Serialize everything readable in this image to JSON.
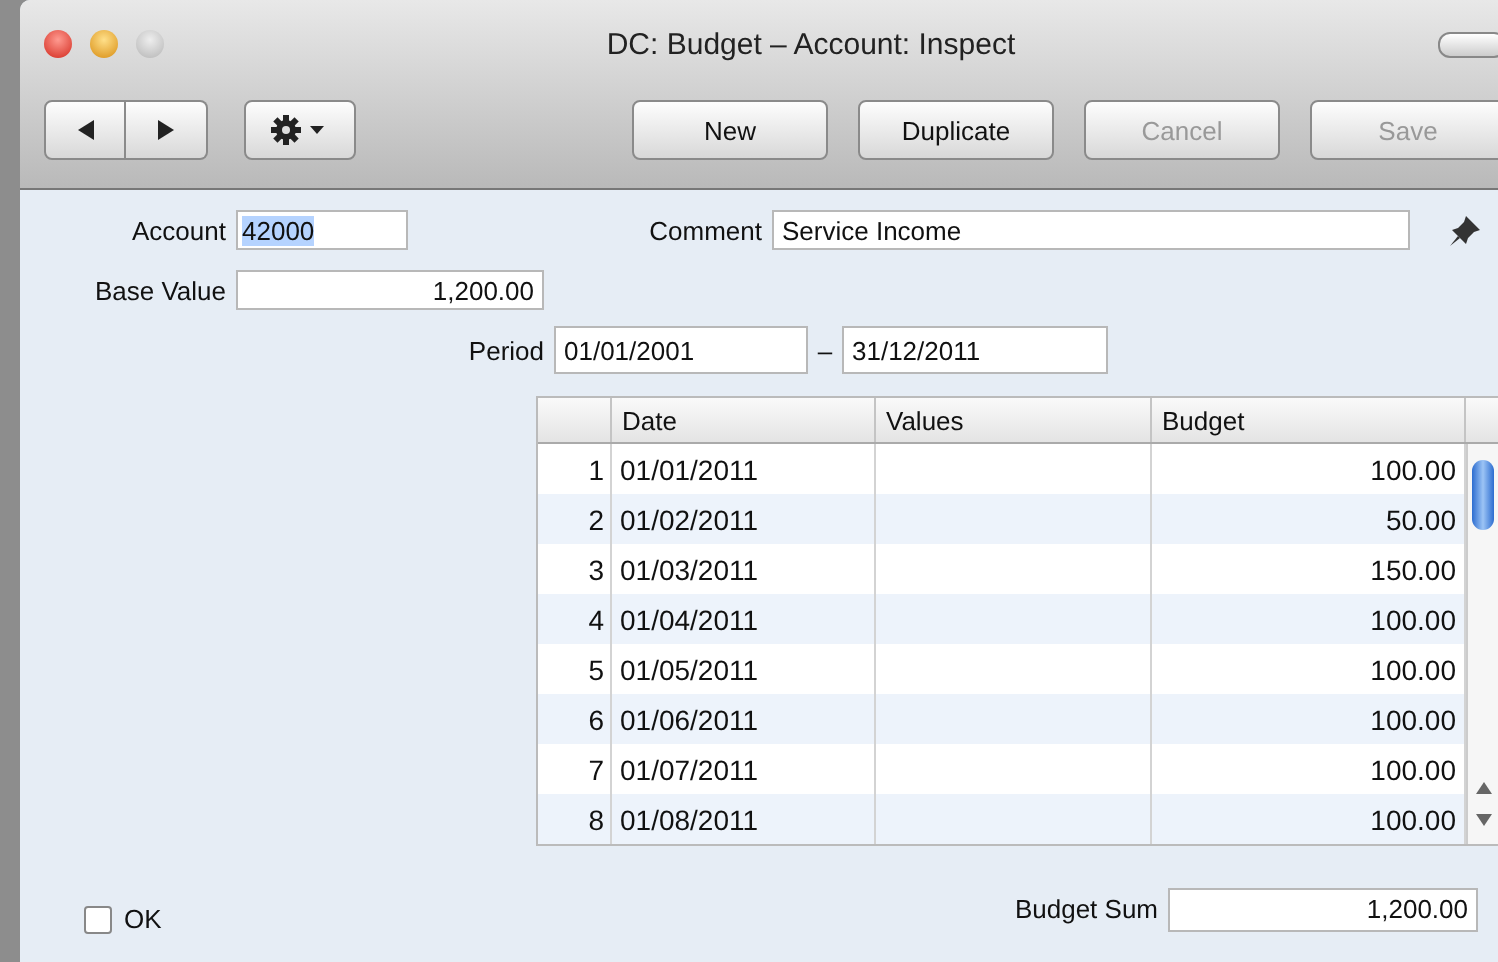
{
  "window": {
    "title": "DC: Budget – Account: Inspect"
  },
  "toolbar": {
    "buttons": [
      {
        "label": "New",
        "disabled": false
      },
      {
        "label": "Duplicate",
        "disabled": false
      },
      {
        "label": "Cancel",
        "disabled": true
      },
      {
        "label": "Save",
        "disabled": true
      }
    ]
  },
  "account": {
    "label": "Account",
    "value": "42000",
    "selected": true
  },
  "comment": {
    "label": "Comment",
    "value": "Service Income"
  },
  "base_value": {
    "label": "Base Value",
    "value": "1,200.00"
  },
  "period": {
    "label": "Period",
    "from": "01/01/2001",
    "separator": "–",
    "to": "31/12/2011"
  },
  "table": {
    "columns": [
      "Date",
      "Values",
      "Budget"
    ],
    "rows": [
      {
        "number": "1",
        "date": "01/01/2011",
        "budget": "100.00"
      },
      {
        "number": "2",
        "date": "01/02/2011",
        "budget": "50.00"
      },
      {
        "number": "3",
        "date": "01/03/2011",
        "budget": "150.00"
      },
      {
        "number": "4",
        "date": "01/04/2011",
        "budget": "100.00"
      },
      {
        "number": "5",
        "date": "01/05/2011",
        "budget": "100.00"
      },
      {
        "number": "6",
        "date": "01/06/2011",
        "budget": "100.00"
      },
      {
        "number": "7",
        "date": "01/07/2011",
        "budget": "100.00"
      },
      {
        "number": "8",
        "date": "01/08/2011",
        "budget": "100.00"
      }
    ]
  },
  "ok": {
    "label": "OK",
    "checked": false
  },
  "budget_sum": {
    "label": "Budget Sum",
    "value": "1,200.00"
  }
}
